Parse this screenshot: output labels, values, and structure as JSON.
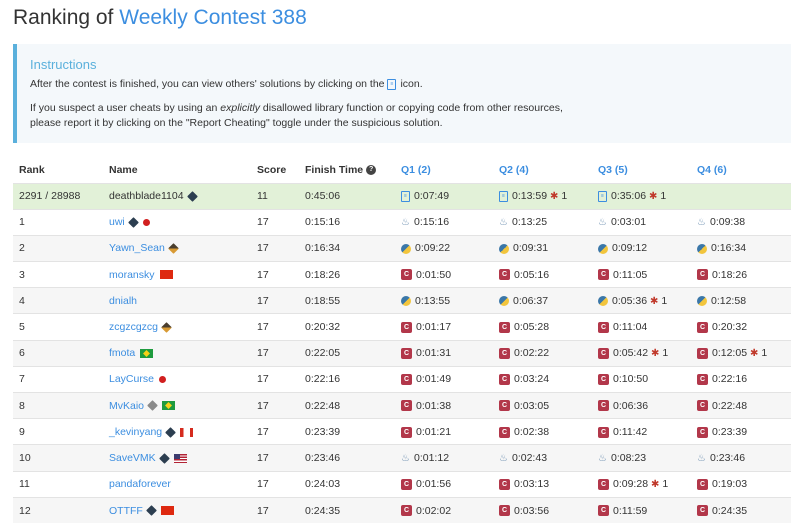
{
  "title": {
    "prefix": "Ranking of",
    "contest": "Weekly Contest 388"
  },
  "instructions": {
    "heading": "Instructions",
    "p1_before": "After the contest is finished, you can view others' solutions by clicking on the",
    "p1_after": "icon.",
    "p2_line1_before": "If you suspect a user cheats by using an",
    "p2_emph": "explicitly",
    "p2_line1_after": "disallowed library function or copying code from other resources,",
    "p2_line2": "please report it by clicking on the \"Report Cheating\" toggle under the suspicious solution."
  },
  "headers": {
    "rank": "Rank",
    "name": "Name",
    "score": "Score",
    "finish": "Finish Time",
    "q1": "Q1 (2)",
    "q2": "Q2 (4)",
    "q3": "Q3 (5)",
    "q4": "Q4 (6)"
  },
  "me": {
    "rank": "2291 / 28988",
    "name": "deathblade1104",
    "score": "11",
    "finish": "0:45:06",
    "q1": "0:07:49",
    "q2": "0:13:59",
    "q2_bugs": "1",
    "q3": "0:35:06",
    "q3_bugs": "1"
  },
  "rows": [
    {
      "rank": "1",
      "name": "uwi",
      "score": "17",
      "finish": "0:15:16",
      "q1": "0:15:16",
      "q2": "0:13:25",
      "q3": "0:03:01",
      "q4": "0:09:38"
    },
    {
      "rank": "2",
      "name": "Yawn_Sean",
      "score": "17",
      "finish": "0:16:34",
      "q1": "0:09:22",
      "q2": "0:09:31",
      "q3": "0:09:12",
      "q4": "0:16:34"
    },
    {
      "rank": "3",
      "name": "moransky",
      "score": "17",
      "finish": "0:18:26",
      "q1": "0:01:50",
      "q2": "0:05:16",
      "q3": "0:11:05",
      "q4": "0:18:26"
    },
    {
      "rank": "4",
      "name": "dnialh",
      "score": "17",
      "finish": "0:18:55",
      "q1": "0:13:55",
      "q2": "0:06:37",
      "q3": "0:05:36",
      "q3_bugs": "1",
      "q4": "0:12:58"
    },
    {
      "rank": "5",
      "name": "zcgzcgzcg",
      "score": "17",
      "finish": "0:20:32",
      "q1": "0:01:17",
      "q2": "0:05:28",
      "q3": "0:11:04",
      "q4": "0:20:32"
    },
    {
      "rank": "6",
      "name": "fmota",
      "score": "17",
      "finish": "0:22:05",
      "q1": "0:01:31",
      "q2": "0:02:22",
      "q3": "0:05:42",
      "q3_bugs": "1",
      "q4": "0:12:05",
      "q4_bugs": "1"
    },
    {
      "rank": "7",
      "name": "LayCurse",
      "score": "17",
      "finish": "0:22:16",
      "q1": "0:01:49",
      "q2": "0:03:24",
      "q3": "0:10:50",
      "q4": "0:22:16"
    },
    {
      "rank": "8",
      "name": "MvKaio",
      "score": "17",
      "finish": "0:22:48",
      "q1": "0:01:38",
      "q2": "0:03:05",
      "q3": "0:06:36",
      "q4": "0:22:48"
    },
    {
      "rank": "9",
      "name": "_kevinyang",
      "score": "17",
      "finish": "0:23:39",
      "q1": "0:01:21",
      "q2": "0:02:38",
      "q3": "0:11:42",
      "q4": "0:23:39"
    },
    {
      "rank": "10",
      "name": "SaveVMK",
      "score": "17",
      "finish": "0:23:46",
      "q1": "0:01:12",
      "q2": "0:02:43",
      "q3": "0:08:23",
      "q4": "0:23:46"
    },
    {
      "rank": "11",
      "name": "pandaforever",
      "score": "17",
      "finish": "0:24:03",
      "q1": "0:01:56",
      "q2": "0:03:13",
      "q3": "0:09:28",
      "q3_bugs": "1",
      "q4": "0:19:03"
    },
    {
      "rank": "12",
      "name": "OTTFF",
      "score": "17",
      "finish": "0:24:35",
      "q1": "0:02:02",
      "q2": "0:03:56",
      "q3": "0:11:59",
      "q4": "0:24:35"
    }
  ]
}
